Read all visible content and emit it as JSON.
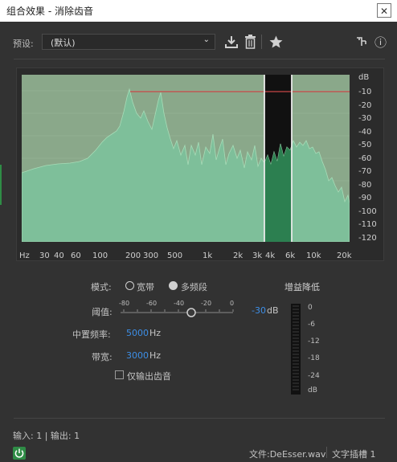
{
  "window": {
    "title": "组合效果 - 消除齿音",
    "close_glyph": "✕"
  },
  "preset": {
    "label": "预设:",
    "value": "(默认)"
  },
  "toolbar": {
    "icons": [
      "download-icon",
      "trash-icon",
      "star-icon",
      "routing-icon",
      "info-icon"
    ],
    "info_glyph": "ⓘ"
  },
  "graph": {
    "db_scale": [
      "dB",
      "-10",
      "-20",
      "-30",
      "-40",
      "-50",
      "-60",
      "-70",
      "-80",
      "-90",
      "-100",
      "-110",
      "-120"
    ],
    "freq_scale": [
      "Hz",
      "30",
      "40",
      "60",
      "100",
      "200",
      "300",
      "500",
      "1k",
      "2k",
      "3k",
      "4k",
      "6k",
      "10k",
      "20k"
    ],
    "threshold_db": -10,
    "band_low_hz": 3000,
    "band_high_hz": 6000,
    "colors": {
      "spectrum": "#7ebf9a",
      "band": "#247848",
      "threshold": "#c84646",
      "plot_bg": "#8aa88a"
    }
  },
  "mode": {
    "label": "模式:",
    "options": [
      "宽带",
      "多频段"
    ],
    "selected": "多频段"
  },
  "threshold": {
    "label": "阈值:",
    "ticks": [
      "-80",
      "-60",
      "-40",
      "-20",
      "0"
    ],
    "value": "-30",
    "unit": "dB"
  },
  "center_freq": {
    "label": "中置频率:",
    "value": "5000",
    "unit": "Hz"
  },
  "bandwidth": {
    "label": "带宽:",
    "value": "3000",
    "unit": "Hz"
  },
  "output_only": {
    "label": "仅输出齿音",
    "checked": false
  },
  "gain_reduction": {
    "title": "增益降低",
    "scale": [
      "0",
      "-6",
      "-12",
      "-18",
      "-24",
      "dB"
    ]
  },
  "io": {
    "text": "输入: 1 | 输出: 1"
  },
  "status": {
    "file": "文件:DeEsser.wav",
    "slot": "文字插槽 1"
  }
}
